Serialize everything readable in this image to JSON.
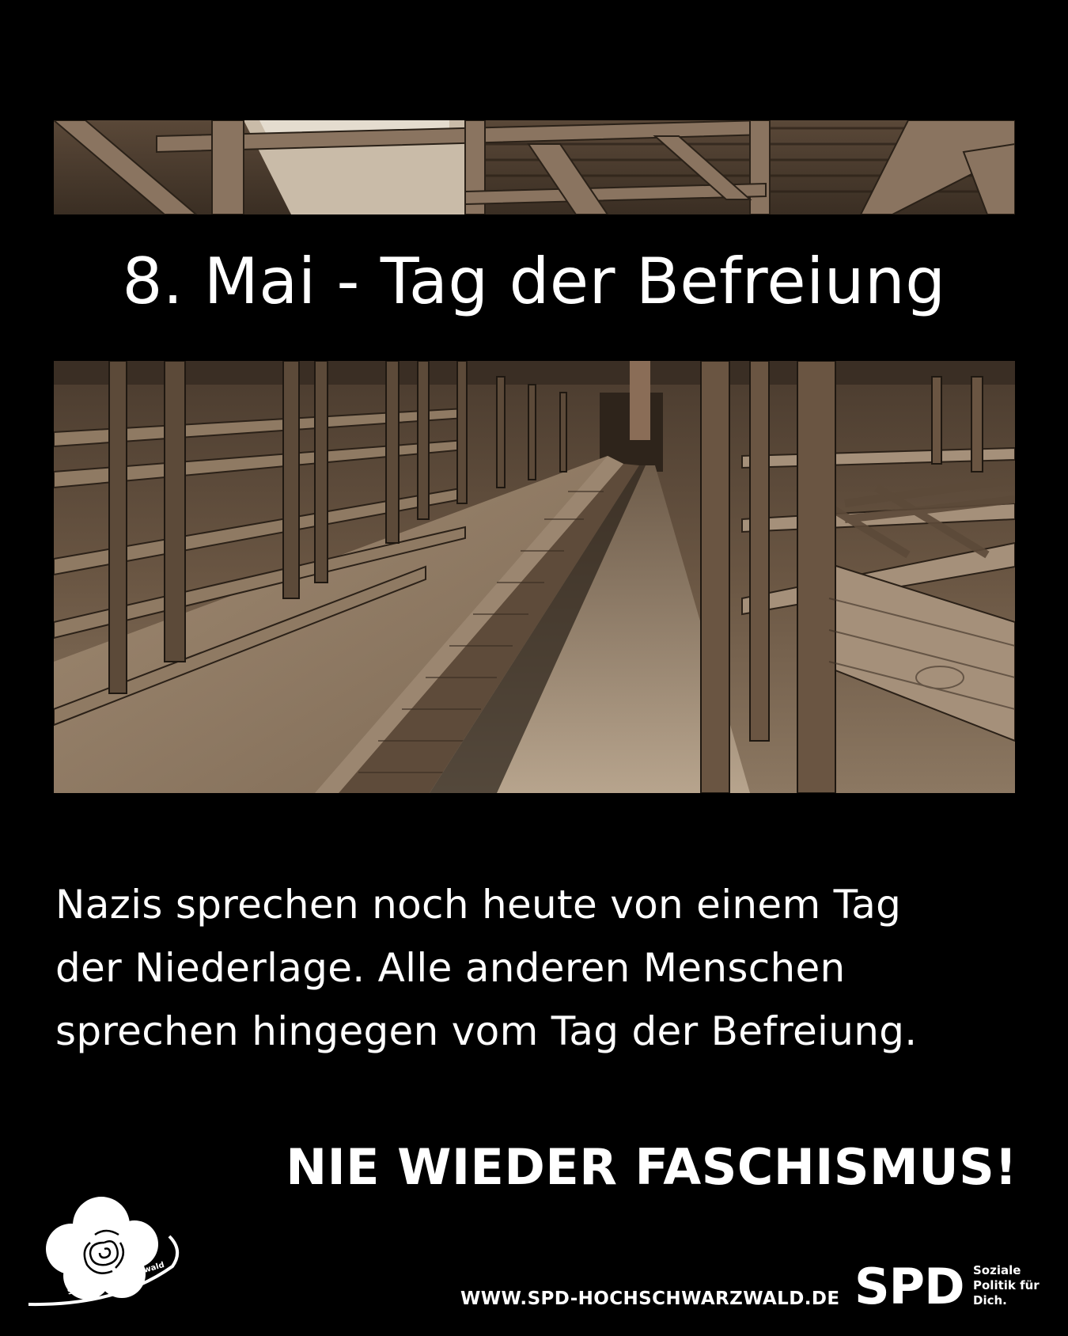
{
  "headline": "8. Mai - Tag der Befreiung",
  "body_lines": [
    "Nazis sprechen noch heute von einem Tag",
    "der Niederlage. Alle anderen Menschen",
    "sprechen hingegen vom Tag der Befreiung."
  ],
  "slogan": "NIE WIEDER FASCHISMUS!",
  "website": "WWW.SPD-HOCHSCHWARZWALD.DE",
  "rose_logo_text": "SPD Hochschwarzwald",
  "spd_logo": {
    "wordmark": "SPD",
    "claim_lines": [
      "Soziale",
      "Politik für",
      "Dich."
    ]
  },
  "colors": {
    "background": "#000000",
    "text": "#ffffff",
    "sepia_dark": "#2a2118",
    "sepia_mid": "#6b5744",
    "sepia_light": "#b9a68e"
  },
  "icons": {
    "rose_logo": "spd-rose-logo-icon",
    "photo_top": "barrack-roof-photo",
    "photo_main": "barrack-bunks-photo"
  }
}
